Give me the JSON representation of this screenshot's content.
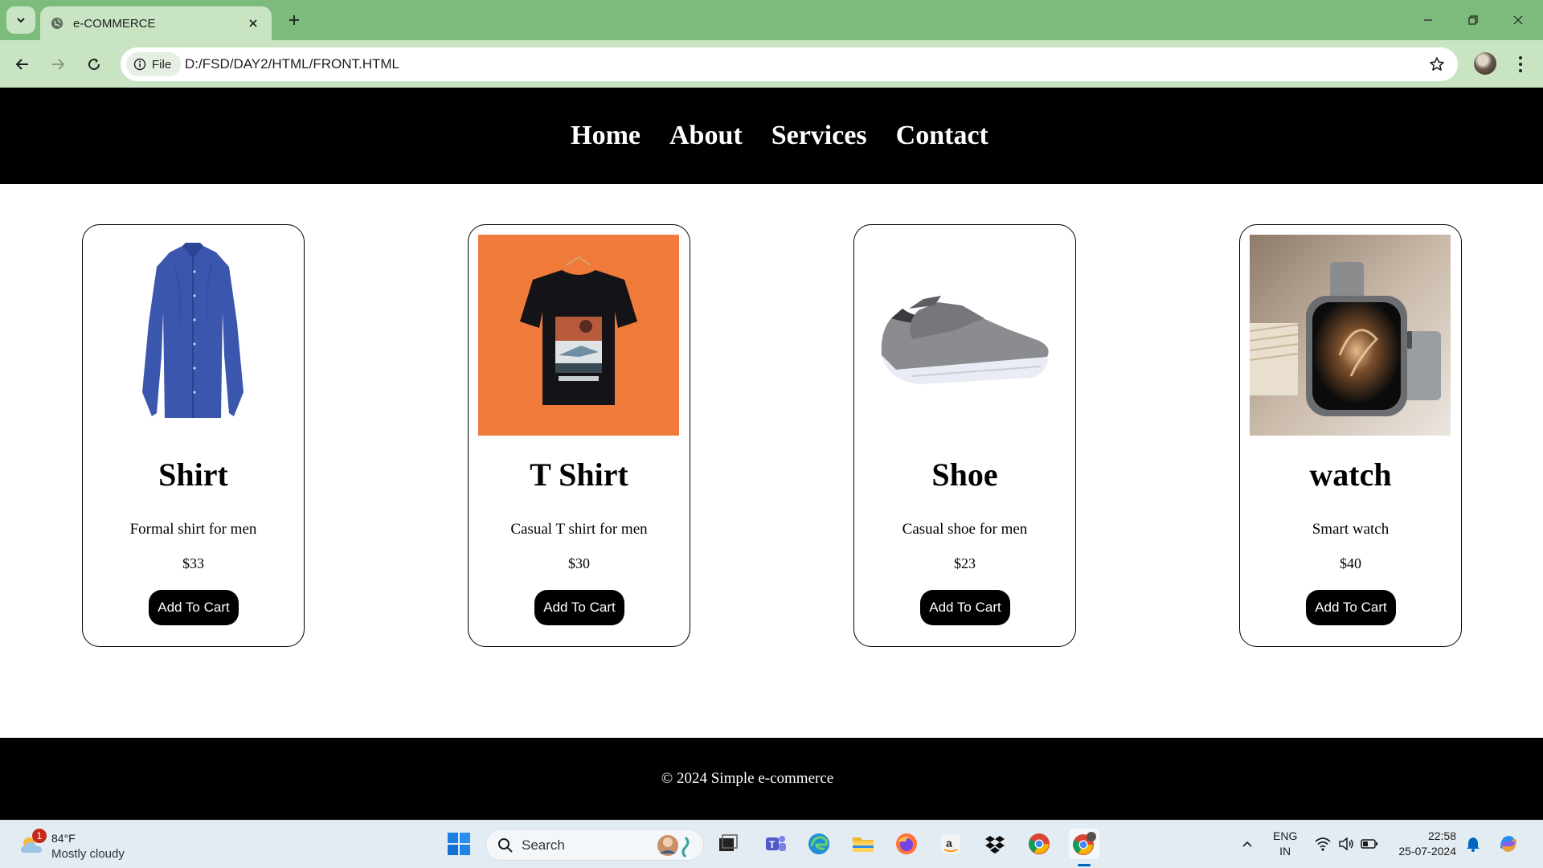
{
  "browser": {
    "tab": {
      "title": "e-COMMERCE"
    },
    "address_bar": {
      "chip_label": "File",
      "url": "D:/FSD/DAY2/HTML/FRONT.HTML"
    }
  },
  "site": {
    "nav": [
      "Home",
      "About",
      "Services",
      "Contact"
    ],
    "products": [
      {
        "name": "Shirt",
        "description": "Formal shirt for men",
        "price": "$33",
        "button": "Add To Cart",
        "image": "blue-shirt"
      },
      {
        "name": "T Shirt",
        "description": "Casual T shirt for men",
        "price": "$30",
        "button": "Add To Cart",
        "image": "black-tshirt-orange-bg"
      },
      {
        "name": "Shoe",
        "description": "Casual shoe for men",
        "price": "$23",
        "button": "Add To Cart",
        "image": "grey-sneakers"
      },
      {
        "name": "watch",
        "description": "Smart watch",
        "price": "$40",
        "button": "Add To Cart",
        "image": "smartwatch"
      }
    ],
    "footer": "© 2024 Simple e-commerce"
  },
  "taskbar": {
    "weather": {
      "temp": "84°F",
      "desc": "Mostly cloudy",
      "badge": "1"
    },
    "search": {
      "label": "Search"
    },
    "lang": {
      "line1": "ENG",
      "line2": "IN"
    },
    "clock": {
      "time": "22:58",
      "date": "25-07-2024"
    }
  },
  "colors": {
    "tabstrip": "#7dbb7c",
    "toolbar": "#c8e4c3",
    "header_bg": "#000000",
    "button_bg": "#000000"
  }
}
